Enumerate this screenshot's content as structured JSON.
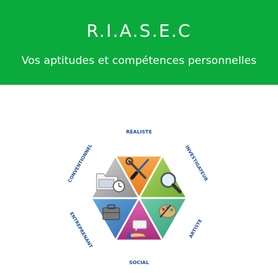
{
  "header": {
    "title": "R.I.A.S.E.C",
    "subtitle": "Vos aptitudes et compétences personnelles"
  },
  "riasec": {
    "segments": [
      {
        "label": "RÉALISTE",
        "icon": "wrench-screwdriver-icon",
        "color": "#f08a24"
      },
      {
        "label": "INVESTIGATEUR",
        "icon": "magnifier-icon",
        "color": "#8cc63f"
      },
      {
        "label": "ARTISTE",
        "icon": "palette-icon",
        "color": "#4db896"
      },
      {
        "label": "SOCIAL",
        "icon": "speech-hand-icon",
        "color": "#cc3c96"
      },
      {
        "label": "ENTREPRENANT",
        "icon": "briefcase-icon",
        "color": "#3c82c8"
      },
      {
        "label": "CONVENTIONNEL",
        "icon": "folder-clock-icon",
        "color": "#a8a8a8"
      }
    ],
    "label_color": "#1f4f9a"
  },
  "colors": {
    "header_bg": "#0aaa3c",
    "header_text": "#ffffff"
  }
}
